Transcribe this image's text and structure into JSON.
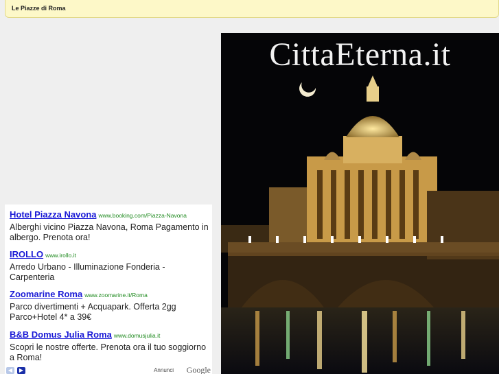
{
  "header": {
    "breadcrumb": "Le Piazze di Roma"
  },
  "ads": {
    "items": [
      {
        "title": "Hotel Piazza Navona",
        "url": "www.booking.com/Piazza-Navona",
        "description": "Alberghi vicino Piazza Navona, Roma Pagamento in albergo. Prenota ora!"
      },
      {
        "title": "IROLLO",
        "url": "www.irollo.it",
        "description": "Arredo Urbano - Illuminazione Fonderia - Carpenteria"
      },
      {
        "title": "Zoomarine Roma",
        "url": "www.zoomarine.it/Roma",
        "description": "Parco divertimenti + Acquapark. Offerta 2gg Parco+Hotel 4* a 39€"
      },
      {
        "title": "B&B Domus Julia Roma",
        "url": "www.domusjulia.it",
        "description": "Scopri le nostre offerte. Prenota ora il tuo soggiorno a Roma!"
      }
    ],
    "footer": {
      "label": "Annunci",
      "logo": "Google",
      "prev_icon": "chevron-left-icon",
      "next_icon": "chevron-right-icon"
    }
  },
  "photo": {
    "title": "CittaEterna.it"
  },
  "colors": {
    "topbar_bg": "#fdf8c8",
    "ad_link": "#1a1ad6",
    "ad_url": "#1f8a1f",
    "page_bg": "#efefef"
  }
}
